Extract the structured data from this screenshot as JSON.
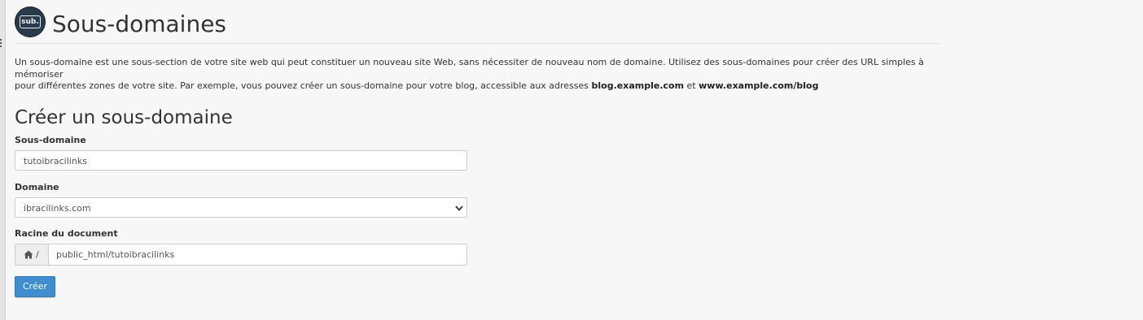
{
  "header": {
    "logo_text": "sub.",
    "title": "Sous-domaines"
  },
  "description": {
    "line1": "Un sous-domaine est une sous-section de votre site web qui peut constituer un nouveau site Web, sans nécessiter de nouveau nom de domaine. Utilisez des sous-domaines pour créer des URL simples à mémoriser",
    "line2_prefix": "pour différentes zones de votre site. Par exemple, vous pouvez créer un sous-domaine pour votre blog, accessible aux adresses ",
    "example1": "blog.example.com",
    "and": " et ",
    "example2": "www.example.com/blog"
  },
  "form": {
    "section_title": "Créer un sous-domaine",
    "subdomain": {
      "label": "Sous-domaine",
      "value": "tutoibracilinks"
    },
    "domain": {
      "label": "Domaine",
      "selected": "ibracilinks.com"
    },
    "docroot": {
      "label": "Racine du document",
      "prefix": "/",
      "value": "public_html/tutoibracilinks"
    },
    "submit_label": "Créer"
  },
  "icons": {
    "home": "home-icon",
    "select_arrow": "chevron-down-icon"
  }
}
